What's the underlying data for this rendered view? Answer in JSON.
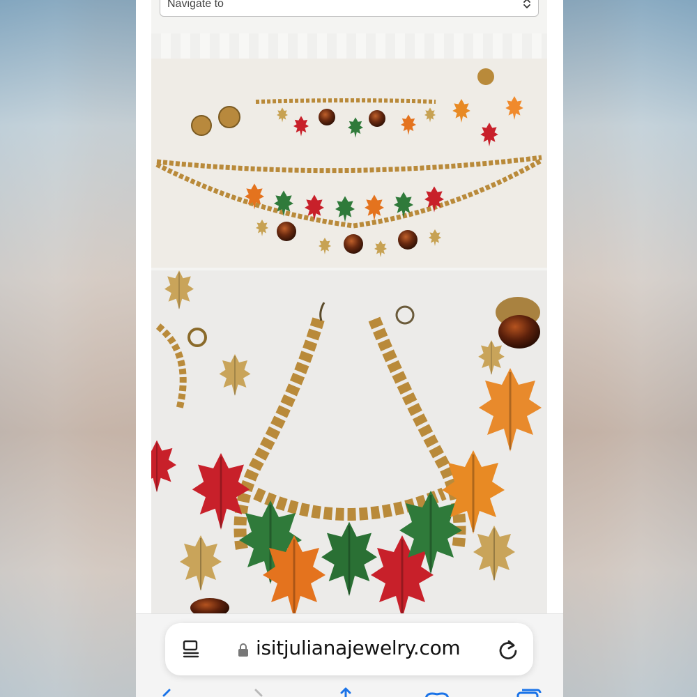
{
  "navigation": {
    "select_label": "Navigate to"
  },
  "browser": {
    "url": "isitjulianajewelry.com"
  },
  "icons": {
    "reader": "reader-mode-icon",
    "lock": "lock-icon",
    "reload": "reload-icon",
    "chevron": "chevron-up-down-icon",
    "back": "back-icon",
    "forward": "forward-icon",
    "share": "share-icon",
    "bookmarks": "bookmarks-icon",
    "tabs": "tabs-icon"
  },
  "colors": {
    "accent": "#1a73e8",
    "leaf_red": "#c8202a",
    "leaf_green": "#2f7a3a",
    "leaf_orange": "#e4731e",
    "gold": "#b98a3a",
    "acorn": "#5a2410"
  }
}
